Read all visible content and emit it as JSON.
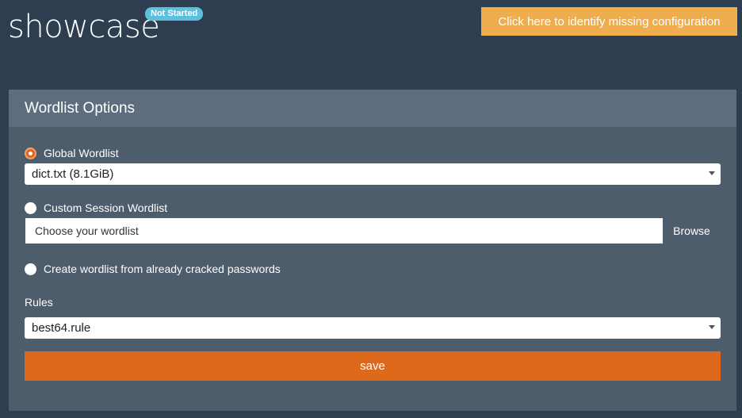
{
  "header": {
    "title": "showcase",
    "status_badge": "Not Started",
    "config_button_label": "Click here to identify missing configuration"
  },
  "panel": {
    "title": "Wordlist Options",
    "global_wordlist": {
      "label": "Global Wordlist",
      "checked": true,
      "selected_value": "dict.txt (8.1GiB)"
    },
    "custom_wordlist": {
      "label": "Custom Session Wordlist",
      "checked": false,
      "placeholder": "Choose your wordlist",
      "browse_label": "Browse"
    },
    "cracked_wordlist": {
      "label": "Create wordlist from already cracked passwords",
      "checked": false
    },
    "rules": {
      "label": "Rules",
      "selected_value": "best64.rule"
    },
    "save_label": "save"
  },
  "colors": {
    "background": "#2c3e50",
    "panel": "#4e5d6c",
    "panel_header": "#5d6d7e",
    "accent_orange": "#df691a",
    "warning": "#f0ad4e",
    "info_badge": "#5bc0de"
  }
}
